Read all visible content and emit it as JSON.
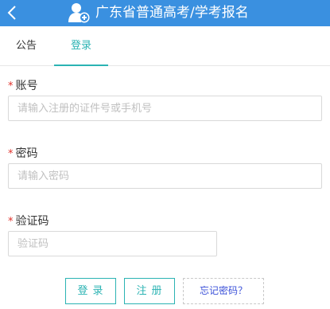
{
  "header": {
    "title": "广东省普通高考/学考报名",
    "back_icon": "chevron-left-icon",
    "user_icon": "user-add-icon",
    "bg_color": "#3a90e0"
  },
  "tabs": [
    {
      "label": "公告",
      "active": false
    },
    {
      "label": "登录",
      "active": true
    }
  ],
  "form": {
    "required_mark": "*",
    "account": {
      "label": "账号",
      "placeholder": "请输入注册的证件号或手机号",
      "value": ""
    },
    "password": {
      "label": "密码",
      "placeholder": "请输入密码",
      "value": ""
    },
    "captcha": {
      "label": "验证码",
      "placeholder": "验证码",
      "value": ""
    }
  },
  "buttons": {
    "login": "登录",
    "register": "注册",
    "forgot": "忘记密码？"
  },
  "colors": {
    "accent": "#2bb3b3",
    "required": "#e0302a",
    "link": "#3a50d8"
  }
}
